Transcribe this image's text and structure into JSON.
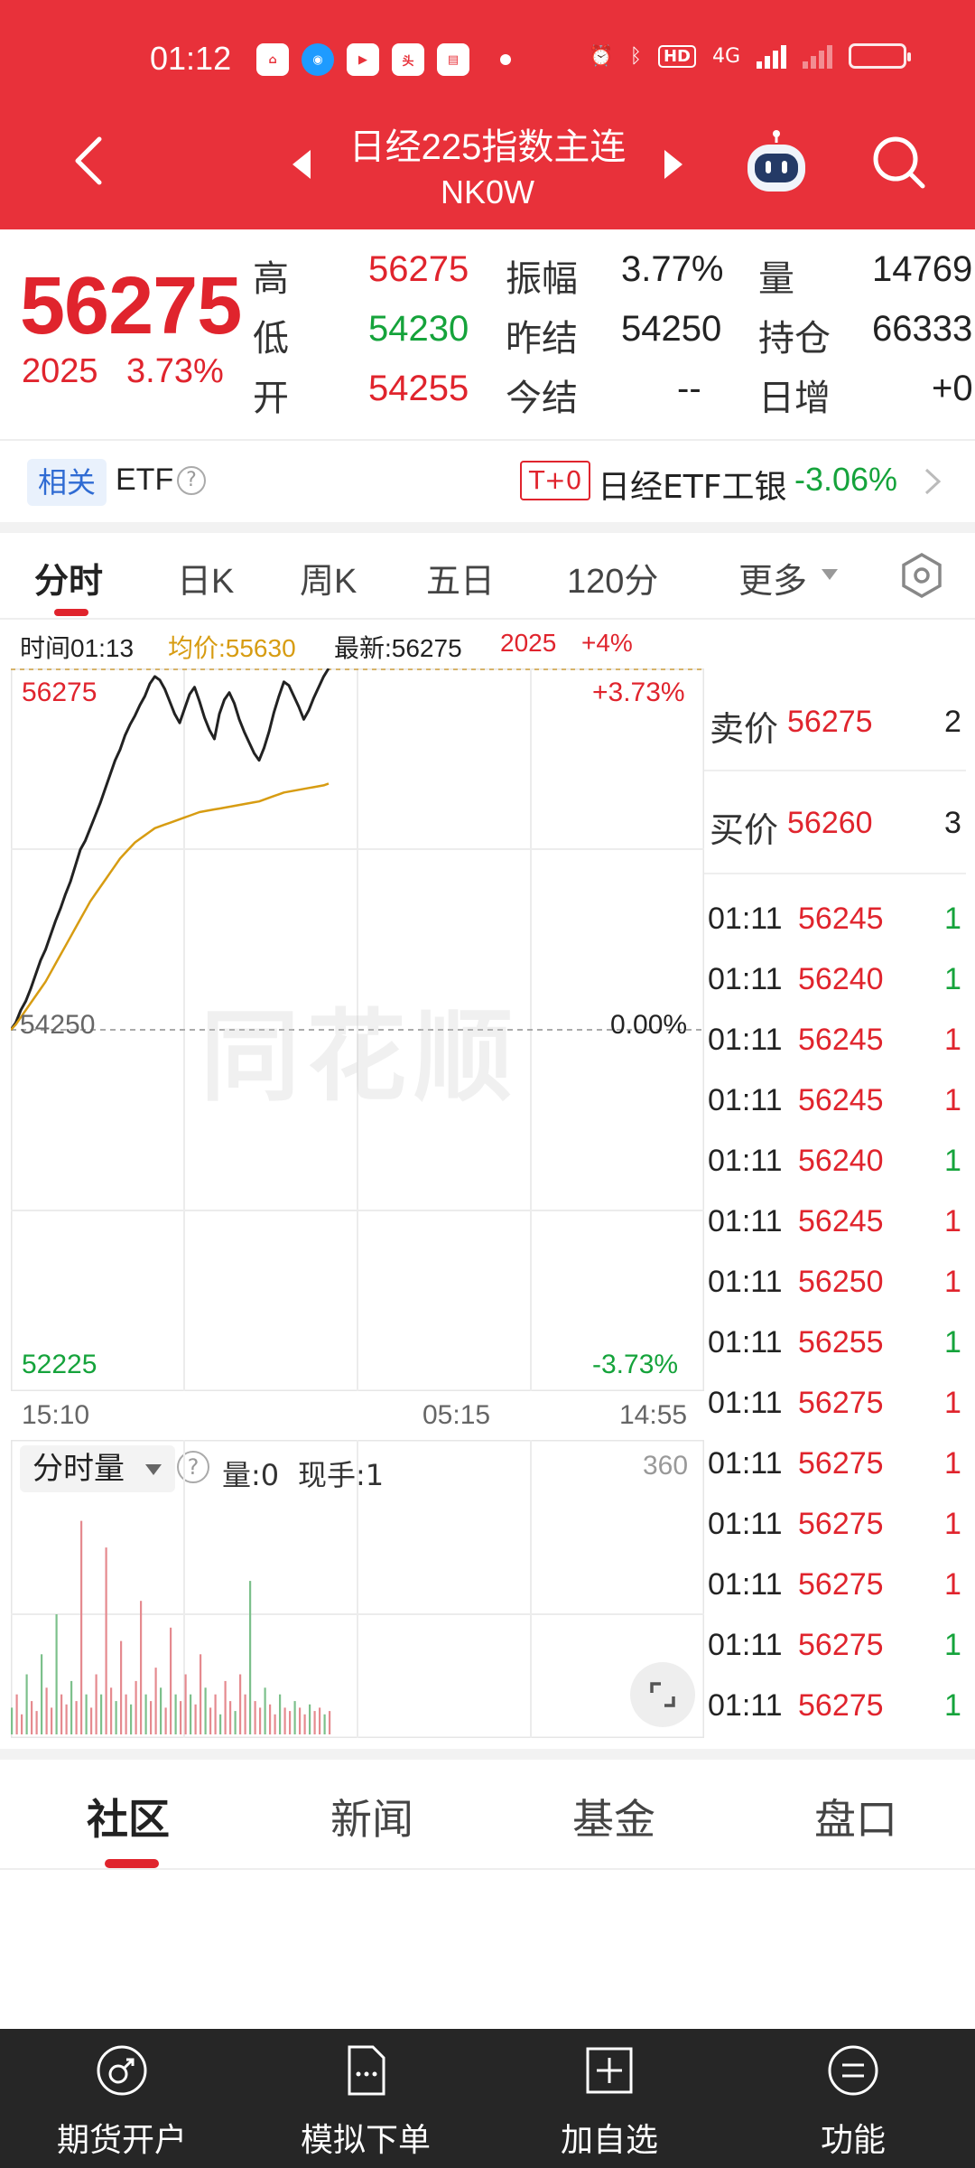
{
  "status_bar": {
    "time": "01:12",
    "network": "4G",
    "hd": "HD"
  },
  "nav": {
    "title": "日经225指数主连",
    "code": "NK0W"
  },
  "quote": {
    "price": "56275",
    "change": "2025",
    "change_pct": "3.73%",
    "rows": [
      {
        "l1": "高",
        "v1": "56275",
        "l2": "振幅",
        "v2": "3.77%",
        "l3": "量",
        "v3": "14769"
      },
      {
        "l1": "低",
        "v1": "54230",
        "l2": "昨结",
        "v2": "54250",
        "l3": "持仓",
        "v3": "66333"
      },
      {
        "l1": "开",
        "v1": "54255",
        "l2": "今结",
        "v2": "--",
        "l3": "日增",
        "v3": "+0"
      }
    ]
  },
  "etf": {
    "tag": "相关",
    "label": "ETF",
    "help": "?",
    "t0": "T+0",
    "name": "日经ETF工银",
    "change": "-3.06%"
  },
  "tabs": {
    "items": [
      "分时",
      "日K",
      "周K",
      "五日",
      "120分",
      "更多"
    ]
  },
  "info": {
    "time": "时间01:13",
    "avg": "均价:55630",
    "latest": "最新:56275",
    "chg": "2025",
    "pct": "+4%"
  },
  "chart": {
    "watermark": "同花顺",
    "top_price": "56275",
    "top_pct": "+3.73%",
    "mid_price": "54250",
    "mid_pct": "0.00%",
    "bottom_price": "52225",
    "bottom_pct": "-3.73%",
    "time_start": "15:10",
    "time_mid": "05:15",
    "time_end": "14:55"
  },
  "chart_data": {
    "type": "line",
    "ylim": [
      52225,
      56275
    ],
    "reference": 54250,
    "series": [
      {
        "name": "最新",
        "values": [
          54250,
          54290,
          54360,
          54410,
          54480,
          54560,
          54640,
          54700,
          54780,
          54860,
          54930,
          55010,
          55080,
          55170,
          55260,
          55310,
          55380,
          55450,
          55520,
          55600,
          55680,
          55760,
          55820,
          55900,
          55960,
          56010,
          56070,
          56120,
          56190,
          56230,
          56210,
          56160,
          56090,
          56020,
          55970,
          56050,
          56130,
          56170,
          56090,
          56000,
          55930,
          55880,
          56020,
          56100,
          56140,
          56080,
          55990,
          55920,
          55860,
          55800,
          55760,
          55830,
          55920,
          56030,
          56120,
          56200,
          56180,
          56120,
          56060,
          55990,
          56040,
          56110,
          56170,
          56230,
          56275
        ]
      },
      {
        "name": "均价",
        "values": [
          54250,
          54280,
          54320,
          54360,
          54400,
          54440,
          54480,
          54520,
          54570,
          54620,
          54670,
          54720,
          54770,
          54820,
          54870,
          54920,
          54970,
          55010,
          55050,
          55090,
          55130,
          55170,
          55210,
          55240,
          55270,
          55300,
          55320,
          55340,
          55360,
          55380,
          55390,
          55400,
          55410,
          55420,
          55430,
          55440,
          55450,
          55460,
          55470,
          55475,
          55480,
          55485,
          55490,
          55495,
          55500,
          55505,
          55510,
          55515,
          55520,
          55525,
          55530,
          55540,
          55550,
          55560,
          55570,
          55580,
          55585,
          55590,
          55595,
          55600,
          55605,
          55610,
          55615,
          55620,
          55630
        ]
      }
    ],
    "volume": {
      "max": 360,
      "values": [
        40,
        60,
        30,
        90,
        50,
        35,
        120,
        70,
        40,
        180,
        60,
        45,
        80,
        50,
        320,
        60,
        40,
        90,
        60,
        280,
        70,
        50,
        140,
        60,
        45,
        80,
        200,
        60,
        50,
        100,
        70,
        40,
        160,
        60,
        50,
        90,
        60,
        45,
        120,
        70,
        40,
        60,
        30,
        80,
        50,
        35,
        90,
        60,
        230,
        50,
        40,
        70,
        45,
        30,
        60,
        40,
        35,
        50,
        40,
        30,
        45,
        35,
        40,
        30,
        35
      ]
    }
  },
  "book": {
    "sell_label": "卖价",
    "sell_price": "56275",
    "sell_vol": "2",
    "buy_label": "买价",
    "buy_price": "56260",
    "buy_vol": "3",
    "trades": [
      {
        "t": "01:11",
        "p": "56245",
        "v": "1",
        "c": "#15a33b"
      },
      {
        "t": "01:11",
        "p": "56240",
        "v": "1",
        "c": "#15a33b"
      },
      {
        "t": "01:11",
        "p": "56245",
        "v": "1",
        "c": "#e0242d"
      },
      {
        "t": "01:11",
        "p": "56245",
        "v": "1",
        "c": "#e0242d"
      },
      {
        "t": "01:11",
        "p": "56240",
        "v": "1",
        "c": "#15a33b"
      },
      {
        "t": "01:11",
        "p": "56245",
        "v": "1",
        "c": "#e0242d"
      },
      {
        "t": "01:11",
        "p": "56250",
        "v": "1",
        "c": "#e0242d"
      },
      {
        "t": "01:11",
        "p": "56255",
        "v": "1",
        "c": "#15a33b"
      },
      {
        "t": "01:11",
        "p": "56275",
        "v": "1",
        "c": "#e0242d"
      },
      {
        "t": "01:11",
        "p": "56275",
        "v": "1",
        "c": "#e0242d"
      },
      {
        "t": "01:11",
        "p": "56275",
        "v": "1",
        "c": "#e0242d"
      },
      {
        "t": "01:11",
        "p": "56275",
        "v": "1",
        "c": "#e0242d"
      },
      {
        "t": "01:11",
        "p": "56275",
        "v": "1",
        "c": "#15a33b"
      },
      {
        "t": "01:11",
        "p": "56275",
        "v": "1",
        "c": "#15a33b"
      }
    ]
  },
  "volume_panel": {
    "dropdown": "分时量",
    "help": "?",
    "qty": "量:0",
    "hand": "现手:1",
    "max_label": "360"
  },
  "sub_tabs": [
    "社区",
    "新闻",
    "基金",
    "盘口"
  ],
  "bottom_bar": [
    "期货开户",
    "模拟下单",
    "加自选",
    "功能"
  ],
  "colors": {
    "brand_red": "#e8313a",
    "up_red": "#e0242d",
    "down_green": "#15a33b",
    "avg_gold": "#d79c12"
  }
}
